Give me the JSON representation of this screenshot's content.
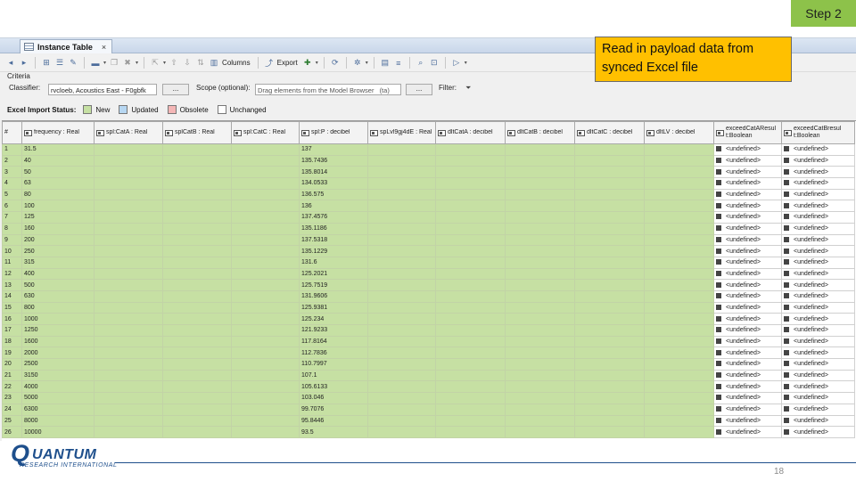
{
  "step_badge": "Step 2",
  "callout_text": "Read in payload data from synced Excel file",
  "tab": {
    "title": "Instance Table",
    "close": "×"
  },
  "toolbar": {
    "columns_label": "Columns",
    "export_label": "Export"
  },
  "criteria": {
    "section_label": "Criteria",
    "classifier_label": "Classifier:",
    "classifier_value": "rvcloeb, Acoustics East - F0gbfk",
    "classifier_button": "...",
    "scope_label": "Scope (optional):",
    "scope_placeholder": "Drag elements from the Model Browser",
    "scope_extra": "(ta)",
    "scope_button": "...",
    "filter_label": "Filter:"
  },
  "import_status": {
    "label": "Excel Import Status:",
    "legend": [
      {
        "label": "New",
        "color": "#c6e0a3"
      },
      {
        "label": "Updated",
        "color": "#b7d7f2"
      },
      {
        "label": "Obsolete",
        "color": "#f4b6b6"
      },
      {
        "label": "Unchanged",
        "color": "#ffffff"
      }
    ]
  },
  "table": {
    "headers": [
      "#",
      "frequency : Real",
      "spl:CatA : Real",
      "splCatB : Real",
      "spl:CatC : Real",
      "spl:P : decibel",
      "spLvl9gj4dE : Real",
      "dltCatA : decibel",
      "dltCatB : decibel",
      "dltCatC : decibel",
      "dltLV : decibel",
      "exceedCatAResul t:Boolean",
      "exceedCatBresul t:Boolean"
    ],
    "rows": [
      [
        "1",
        "31.5",
        "",
        "",
        "",
        "137",
        "",
        "",
        "",
        "",
        "",
        "<undefined>",
        "<undefined>"
      ],
      [
        "2",
        "40",
        "",
        "",
        "",
        "135.7436",
        "",
        "",
        "",
        "",
        "",
        "<undefined>",
        "<undefined>"
      ],
      [
        "3",
        "50",
        "",
        "",
        "",
        "135.8014",
        "",
        "",
        "",
        "",
        "",
        "<undefined>",
        "<undefined>"
      ],
      [
        "4",
        "63",
        "",
        "",
        "",
        "134.0533",
        "",
        "",
        "",
        "",
        "",
        "<undefined>",
        "<undefined>"
      ],
      [
        "5",
        "80",
        "",
        "",
        "",
        "136.575",
        "",
        "",
        "",
        "",
        "",
        "<undefined>",
        "<undefined>"
      ],
      [
        "6",
        "100",
        "",
        "",
        "",
        "136",
        "",
        "",
        "",
        "",
        "",
        "<undefined>",
        "<undefined>"
      ],
      [
        "7",
        "125",
        "",
        "",
        "",
        "137.4576",
        "",
        "",
        "",
        "",
        "",
        "<undefined>",
        "<undefined>"
      ],
      [
        "8",
        "160",
        "",
        "",
        "",
        "135.1186",
        "",
        "",
        "",
        "",
        "",
        "<undefined>",
        "<undefined>"
      ],
      [
        "9",
        "200",
        "",
        "",
        "",
        "137.5318",
        "",
        "",
        "",
        "",
        "",
        "<undefined>",
        "<undefined>"
      ],
      [
        "10",
        "250",
        "",
        "",
        "",
        "135.1229",
        "",
        "",
        "",
        "",
        "",
        "<undefined>",
        "<undefined>"
      ],
      [
        "11",
        "315",
        "",
        "",
        "",
        "131.6",
        "",
        "",
        "",
        "",
        "",
        "<undefined>",
        "<undefined>"
      ],
      [
        "12",
        "400",
        "",
        "",
        "",
        "125.2021",
        "",
        "",
        "",
        "",
        "",
        "<undefined>",
        "<undefined>"
      ],
      [
        "13",
        "500",
        "",
        "",
        "",
        "125.7519",
        "",
        "",
        "",
        "",
        "",
        "<undefined>",
        "<undefined>"
      ],
      [
        "14",
        "630",
        "",
        "",
        "",
        "131.9606",
        "",
        "",
        "",
        "",
        "",
        "<undefined>",
        "<undefined>"
      ],
      [
        "15",
        "800",
        "",
        "",
        "",
        "125.9381",
        "",
        "",
        "",
        "",
        "",
        "<undefined>",
        "<undefined>"
      ],
      [
        "16",
        "1000",
        "",
        "",
        "",
        "125.234",
        "",
        "",
        "",
        "",
        "",
        "<undefined>",
        "<undefined>"
      ],
      [
        "17",
        "1250",
        "",
        "",
        "",
        "121.9233",
        "",
        "",
        "",
        "",
        "",
        "<undefined>",
        "<undefined>"
      ],
      [
        "18",
        "1600",
        "",
        "",
        "",
        "117.8164",
        "",
        "",
        "",
        "",
        "",
        "<undefined>",
        "<undefined>"
      ],
      [
        "19",
        "2000",
        "",
        "",
        "",
        "112.7836",
        "",
        "",
        "",
        "",
        "",
        "<undefined>",
        "<undefined>"
      ],
      [
        "20",
        "2500",
        "",
        "",
        "",
        "110.7997",
        "",
        "",
        "",
        "",
        "",
        "<undefined>",
        "<undefined>"
      ],
      [
        "21",
        "3150",
        "",
        "",
        "",
        "107.1",
        "",
        "",
        "",
        "",
        "",
        "<undefined>",
        "<undefined>"
      ],
      [
        "22",
        "4000",
        "",
        "",
        "",
        "105.6133",
        "",
        "",
        "",
        "",
        "",
        "<undefined>",
        "<undefined>"
      ],
      [
        "23",
        "5000",
        "",
        "",
        "",
        "103.046",
        "",
        "",
        "",
        "",
        "",
        "<undefined>",
        "<undefined>"
      ],
      [
        "24",
        "6300",
        "",
        "",
        "",
        "99.7076",
        "",
        "",
        "",
        "",
        "",
        "<undefined>",
        "<undefined>"
      ],
      [
        "25",
        "8000",
        "",
        "",
        "",
        "95.8446",
        "",
        "",
        "",
        "",
        "",
        "<undefined>",
        "<undefined>"
      ],
      [
        "26",
        "10000",
        "",
        "",
        "",
        "93.5",
        "",
        "",
        "",
        "",
        "",
        "<undefined>",
        "<undefined>"
      ]
    ]
  },
  "footer": {
    "logo_q": "Q",
    "logo_uantum": "UANTUM",
    "logo_sub": "RESEARCH INTERNATIONAL",
    "page_number": "18"
  }
}
